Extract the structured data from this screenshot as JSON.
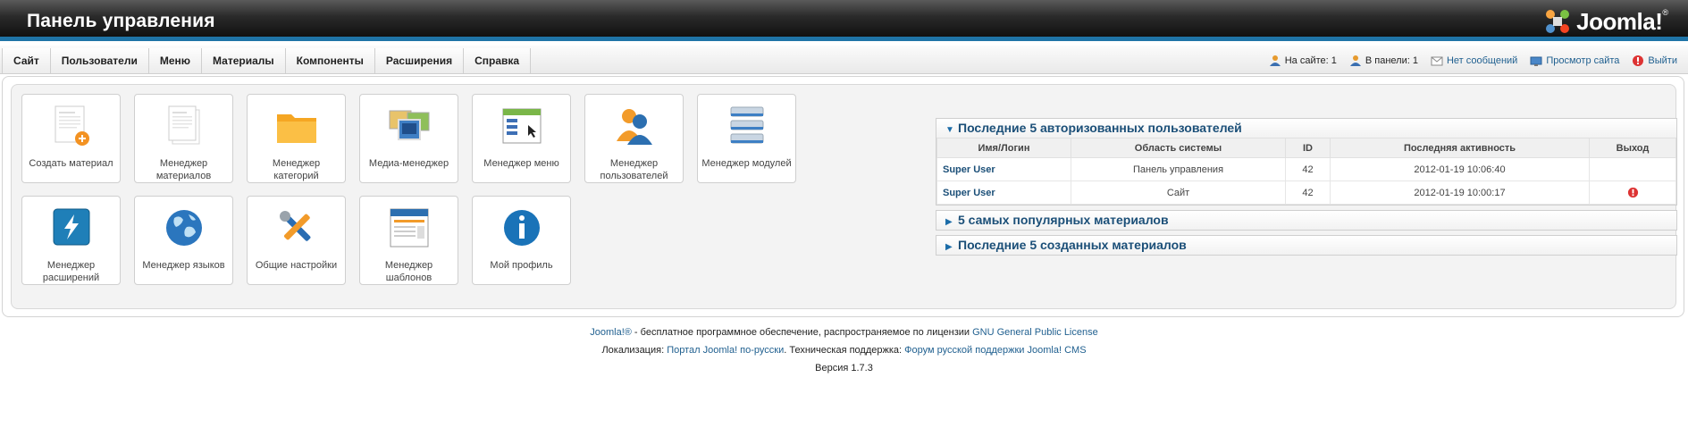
{
  "header": {
    "title": "Панель управления",
    "logo_text": "Joomla!",
    "logo_mark": "®"
  },
  "menu": {
    "items": [
      "Сайт",
      "Пользователи",
      "Меню",
      "Материалы",
      "Компоненты",
      "Расширения",
      "Справка"
    ]
  },
  "status": {
    "on_site": "На сайте: 1",
    "in_panel": "В панели: 1",
    "messages": "Нет сообщений",
    "view_site": "Просмотр сайта",
    "logout": "Выйти"
  },
  "tiles": [
    {
      "label": "Создать материал",
      "icon": "add-article-icon"
    },
    {
      "label": "Менеджер материалов",
      "icon": "articles-icon"
    },
    {
      "label": "Менеджер категорий",
      "icon": "folder-icon"
    },
    {
      "label": "Медиа-менеджер",
      "icon": "media-icon"
    },
    {
      "label": "Менеджер меню",
      "icon": "menu-icon"
    },
    {
      "label": "Менеджер пользователей",
      "icon": "users-icon"
    },
    {
      "label": "Менеджер модулей",
      "icon": "modules-icon"
    },
    {
      "label": "Менеджер расширений",
      "icon": "extensions-icon"
    },
    {
      "label": "Менеджер языков",
      "icon": "globe-icon"
    },
    {
      "label": "Общие настройки",
      "icon": "tools-icon"
    },
    {
      "label": "Менеджер шаблонов",
      "icon": "templates-icon"
    },
    {
      "label": "Мой профиль",
      "icon": "info-icon"
    }
  ],
  "modules": {
    "logged_in": {
      "title": "Последние 5 авторизованных пользователей",
      "columns": [
        "Имя/Логин",
        "Область системы",
        "ID",
        "Последняя активность",
        "Выход"
      ],
      "rows": [
        {
          "name": "Super User",
          "area": "Панель управления",
          "id": "42",
          "activity": "2012-01-19 10:06:40",
          "logout": false
        },
        {
          "name": "Super User",
          "area": "Сайт",
          "id": "42",
          "activity": "2012-01-19 10:00:17",
          "logout": true
        }
      ]
    },
    "popular": {
      "title": "5 самых популярных материалов"
    },
    "latest": {
      "title": "Последние 5 созданных материалов"
    }
  },
  "footer": {
    "line1_link": "Joomla!®",
    "line1_text": " - бесплатное программное обеспечение, распространяемое по лицензии ",
    "line1_license": "GNU General Public License",
    "line2_label": "Локализация: ",
    "line2_link1": "Портал Joomla! по-русски",
    "line2_mid": ". Техническая поддержка: ",
    "line2_link2": "Форум русской поддержки Joomla! CMS",
    "version": "Версия 1.7.3"
  },
  "colors": {
    "accent": "#1f74a7",
    "link": "#1f5f8f",
    "module_title": "#1b4f78"
  }
}
